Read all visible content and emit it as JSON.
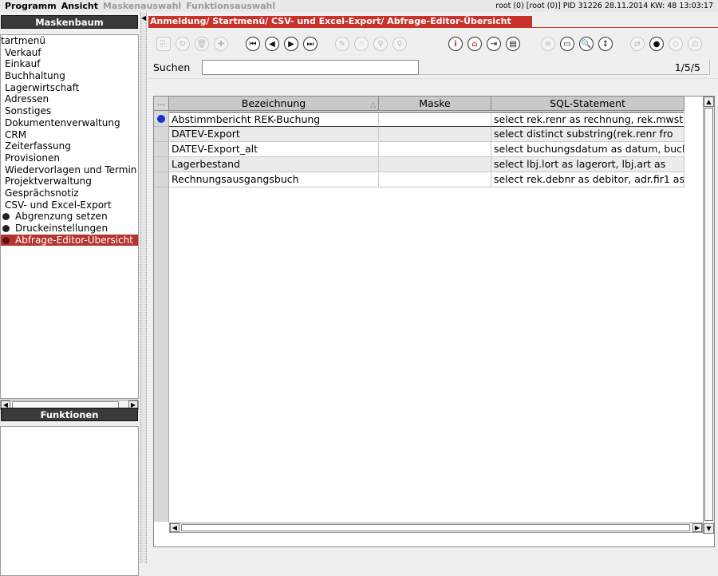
{
  "menubar": {
    "items": [
      {
        "label": "Programm",
        "enabled": true
      },
      {
        "label": "Ansicht",
        "enabled": true
      },
      {
        "label": "Maskenauswahl",
        "enabled": false
      },
      {
        "label": "Funktionsauswahl",
        "enabled": false
      }
    ],
    "status": "root (0) [root (0)] PID 31226  28.11.2014 KW: 48  13:03:17"
  },
  "sidebar": {
    "header": "Maskenbaum",
    "tree": [
      {
        "label": "tartmenü",
        "level": 0
      },
      {
        "label": "Verkauf",
        "level": 1
      },
      {
        "label": "Einkauf",
        "level": 1
      },
      {
        "label": "Buchhaltung",
        "level": 1
      },
      {
        "label": "Lagerwirtschaft",
        "level": 1
      },
      {
        "label": "Adressen",
        "level": 1
      },
      {
        "label": "Sonstiges",
        "level": 1
      },
      {
        "label": "Dokumentenverwaltung",
        "level": 1
      },
      {
        "label": "CRM",
        "level": 1
      },
      {
        "label": "Zeiterfassung",
        "level": 1
      },
      {
        "label": "Provisionen",
        "level": 1
      },
      {
        "label": "Wiedervorlagen und Termin",
        "level": 1
      },
      {
        "label": "Projektverwaltung",
        "level": 1
      },
      {
        "label": "Gesprächsnotiz",
        "level": 1
      },
      {
        "label": "CSV- und Excel-Export",
        "level": 1
      },
      {
        "label": "Abgrenzung setzen",
        "level": 2
      },
      {
        "label": "Druckeinstellungen",
        "level": 2
      },
      {
        "label": "Abfrage-Editor-Übersicht",
        "level": 2,
        "selected": true
      }
    ],
    "functions_header": "Funktionen"
  },
  "main": {
    "title": "Anmeldung/ Startmenü/ CSV- und Excel-Export/ Abfrage-Editor-Übersicht",
    "toolbar_icons": [
      "copy-icon",
      "refresh-icon",
      "delete-icon",
      "add-icon",
      "first-icon",
      "prev-icon",
      "next-icon",
      "last-icon",
      "edit-icon",
      "pointer-icon",
      "search-link-icon",
      "search-back-icon",
      "info-icon",
      "home-icon",
      "exit-icon",
      "print-icon",
      "list-icon",
      "window-icon",
      "magnifier-icon",
      "sort-icon",
      "swap-icon",
      "record-icon",
      "tag-icon",
      "attach-icon"
    ],
    "search": {
      "label": "Suchen",
      "value": "",
      "count": "1/5/5"
    },
    "table": {
      "corner": "...",
      "columns": [
        "Bezeichnung",
        "Maske",
        "SQL-Statement"
      ],
      "rows": [
        {
          "bezeichnung": "Abstimmbericht REK-Buchung",
          "maske": "",
          "sql": "select rek.renr as rechnung, rek.mwst"
        },
        {
          "bezeichnung": "DATEV-Export",
          "maske": "",
          "sql": "select distinct     substring(rek.renr fro"
        },
        {
          "bezeichnung": "DATEV-Export_alt",
          "maske": "",
          "sql": "select buchungsdatum as datum, buch"
        },
        {
          "bezeichnung": "Lagerbestand",
          "maske": "",
          "sql": "select    lbj.lort as lagerort,    lbj.art as"
        },
        {
          "bezeichnung": "Rechnungsausgangsbuch",
          "maske": "",
          "sql": "select rek.debnr as debitor, adr.fir1 as"
        }
      ]
    }
  },
  "colors": {
    "accent": "#c8322b",
    "selection": "#b5342e",
    "header_dark": "#3a3a3a",
    "row_marker": "#1e2fd0"
  }
}
